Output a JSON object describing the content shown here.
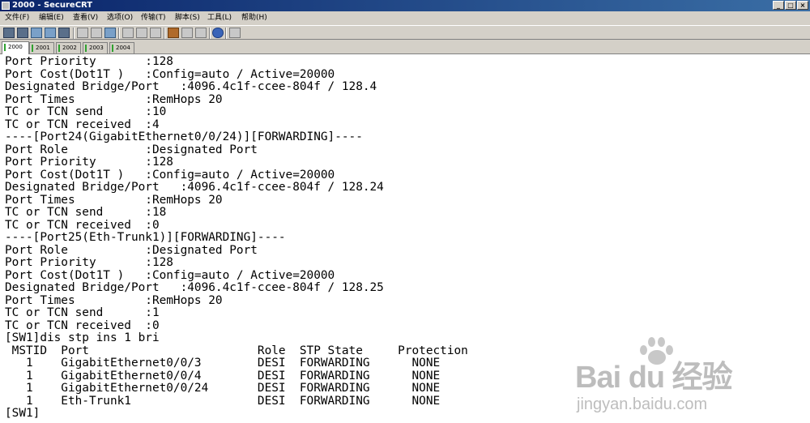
{
  "window": {
    "title": "2000 - SecureCRT",
    "controls": [
      "_",
      "□",
      "×"
    ]
  },
  "menu": [
    "文件(F)",
    "编辑(E)",
    "查看(V)",
    "选项(O)",
    "传输(T)",
    "脚本(S)",
    "工具(L)",
    "帮助(H)"
  ],
  "toolbar": {
    "buttons": [
      "connect-icon",
      "quick-connect-icon",
      "connect-tab-icon",
      "reconnect-icon",
      "disconnect-icon",
      "copy-icon",
      "paste-icon",
      "find-icon",
      "print-icon",
      "print-setup-icon",
      "session-options-icon",
      "global-options-icon",
      "key-map-icon",
      "help-icon",
      "keypad-icon"
    ]
  },
  "tabs": [
    {
      "label": "2000",
      "active": true
    },
    {
      "label": "2001",
      "active": false
    },
    {
      "label": "2002",
      "active": false
    },
    {
      "label": "2003",
      "active": false
    },
    {
      "label": "2004",
      "active": false
    }
  ],
  "terminal": {
    "lines": [
      "Port Priority       :128",
      "Port Cost(Dot1T )   :Config=auto / Active=20000",
      "Designated Bridge/Port   :4096.4c1f-ccee-804f / 128.4",
      "Port Times          :RemHops 20",
      "TC or TCN send      :10",
      "TC or TCN received  :4",
      "----[Port24(GigabitEthernet0/0/24)][FORWARDING]----",
      "Port Role           :Designated Port",
      "Port Priority       :128",
      "Port Cost(Dot1T )   :Config=auto / Active=20000",
      "Designated Bridge/Port   :4096.4c1f-ccee-804f / 128.24",
      "Port Times          :RemHops 20",
      "TC or TCN send      :18",
      "TC or TCN received  :0",
      "----[Port25(Eth-Trunk1)][FORWARDING]----",
      "Port Role           :Designated Port",
      "Port Priority       :128",
      "Port Cost(Dot1T )   :Config=auto / Active=20000",
      "Designated Bridge/Port   :4096.4c1f-ccee-804f / 128.25",
      "Port Times          :RemHops 20",
      "TC or TCN send      :1",
      "TC or TCN received  :0",
      "[SW1]dis stp ins 1 bri",
      " MSTID  Port                        Role  STP State     Protection",
      "   1    GigabitEthernet0/0/3        DESI  FORWARDING      NONE",
      "   1    GigabitEthernet0/0/4        DESI  FORWARDING      NONE",
      "   1    GigabitEthernet0/0/24       DESI  FORWARDING      NONE",
      "   1    Eth-Trunk1                  DESI  FORWARDING      NONE",
      "[SW1]"
    ]
  },
  "watermark": {
    "logo": "Bai du 经验",
    "url": "jingyan.baidu.com"
  }
}
